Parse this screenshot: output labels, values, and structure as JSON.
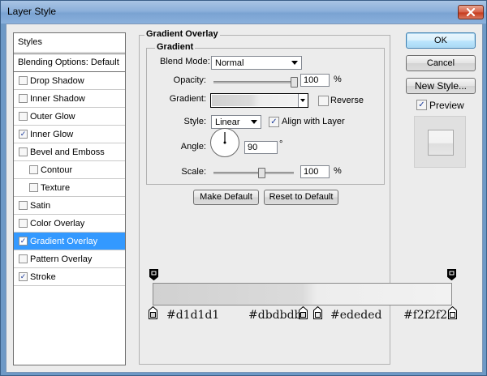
{
  "window": {
    "title": "Layer Style"
  },
  "icons": {
    "close": "close-icon"
  },
  "sidebar": {
    "styles_label": "Styles",
    "blending_label": "Blending Options: Default",
    "items": [
      {
        "label": "Drop Shadow",
        "checked": false,
        "indent": false,
        "selected": false
      },
      {
        "label": "Inner Shadow",
        "checked": false,
        "indent": false,
        "selected": false
      },
      {
        "label": "Outer Glow",
        "checked": false,
        "indent": false,
        "selected": false
      },
      {
        "label": "Inner Glow",
        "checked": true,
        "indent": false,
        "selected": false
      },
      {
        "label": "Bevel and Emboss",
        "checked": false,
        "indent": false,
        "selected": false
      },
      {
        "label": "Contour",
        "checked": false,
        "indent": true,
        "selected": false
      },
      {
        "label": "Texture",
        "checked": false,
        "indent": true,
        "selected": false
      },
      {
        "label": "Satin",
        "checked": false,
        "indent": false,
        "selected": false
      },
      {
        "label": "Color Overlay",
        "checked": false,
        "indent": false,
        "selected": false
      },
      {
        "label": "Gradient Overlay",
        "checked": true,
        "indent": false,
        "selected": true
      },
      {
        "label": "Pattern Overlay",
        "checked": false,
        "indent": false,
        "selected": false
      },
      {
        "label": "Stroke",
        "checked": true,
        "indent": false,
        "selected": false
      }
    ]
  },
  "panel": {
    "title": "Gradient Overlay",
    "subtitle": "Gradient",
    "blend_mode": {
      "label": "Blend Mode:",
      "value": "Normal"
    },
    "opacity": {
      "label": "Opacity:",
      "value": "100",
      "unit": "%",
      "level": 1.0
    },
    "gradient": {
      "label": "Gradient:",
      "reverse_label": "Reverse",
      "reverse_checked": false
    },
    "style": {
      "label": "Style:",
      "value": "Linear",
      "align_label": "Align with Layer",
      "align_checked": true
    },
    "angle": {
      "label": "Angle:",
      "value": "90",
      "unit": "°"
    },
    "scale": {
      "label": "Scale:",
      "value": "100",
      "unit": "%",
      "level": 0.6
    },
    "make_default": "Make Default",
    "reset_default": "Reset to Default"
  },
  "buttons": {
    "ok": "OK",
    "cancel": "Cancel",
    "new_style": "New Style...",
    "preview": "Preview",
    "preview_checked": true
  },
  "gradient_editor": {
    "stops": [
      {
        "color": "#d1d1d1",
        "label": "#d1d1d1"
      },
      {
        "color": "#dbdbdb",
        "label": "#dbdbdb"
      },
      {
        "color": "#ededed",
        "label": "#ededed"
      },
      {
        "color": "#f2f2f2",
        "label": "#f2f2f2"
      }
    ]
  }
}
